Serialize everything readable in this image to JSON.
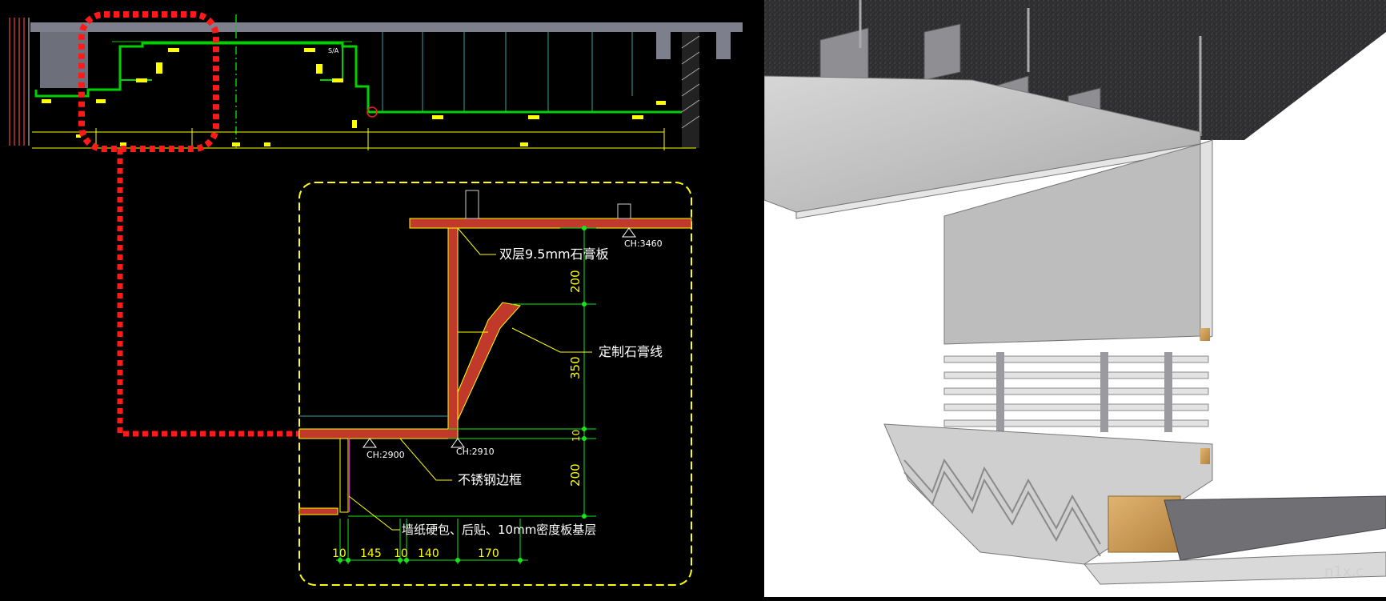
{
  "cad_panel": {
    "section_marks": {
      "small_tag_top": "S/A"
    },
    "annotations": {
      "double_gypsum": "双层9.5mm石膏板",
      "custom_cornice": "定制石膏线",
      "stainless_frame": "不锈钢边框",
      "wallpaper_note": "墙纸硬包、后贴、10mm密度板基层"
    },
    "ceiling_heights": {
      "ch_top": "CH:3460",
      "ch_mid_left": "CH:2900",
      "ch_mid_right": "CH:2910"
    },
    "vertical_dimensions": {
      "d1": "200",
      "d2": "350",
      "d3": "10",
      "d4": "200"
    },
    "horizontal_dimensions": {
      "h1": "10",
      "h2": "145",
      "h3": "10",
      "h4": "140",
      "h5": "170"
    },
    "colors": {
      "background": "#000000",
      "linework_green": "#00d000",
      "dimension_green": "#19e619",
      "annotation_yellow": "#ffff00",
      "callout_red": "#ff1a1a",
      "hatch_brown": "#c0392b",
      "concrete_gray": "#7d7f8c"
    }
  },
  "render_panel": {
    "watermark": "n1x.c",
    "colors": {
      "ceiling_concrete": "#2e2e30",
      "gypsum": "#bdbdbd",
      "steel": "#8e8e93",
      "wood": "#c89b55"
    }
  }
}
